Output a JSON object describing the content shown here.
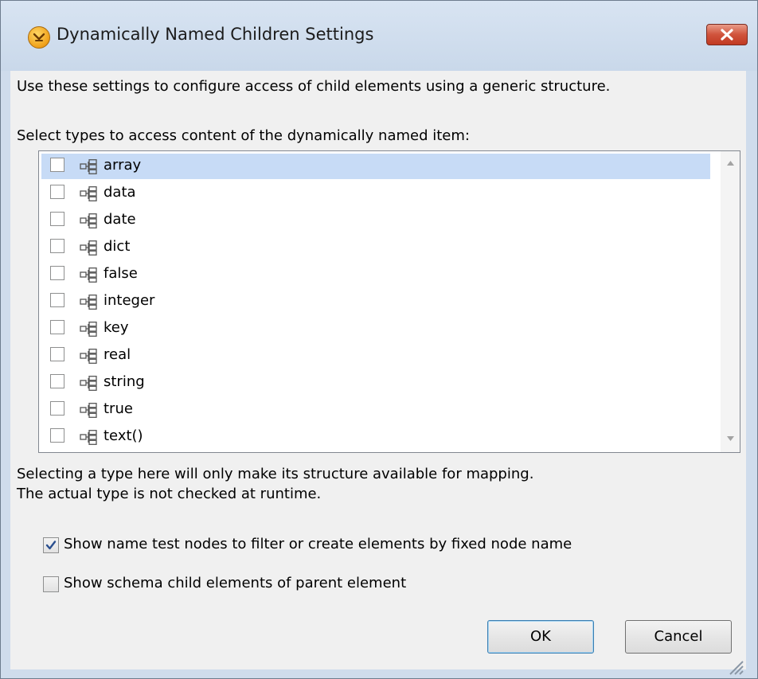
{
  "window": {
    "title": "Dynamically Named Children Settings",
    "icon": "app-logo-icon",
    "close_icon": "close-icon"
  },
  "description": "Use these settings to configure access of child elements using a generic structure.",
  "types_list": {
    "label": "Select types to access content of the dynamically named item:",
    "item_icon": "element-tree-icon",
    "selected_index": 0,
    "items": [
      {
        "label": "array",
        "checked": false
      },
      {
        "label": "data",
        "checked": false
      },
      {
        "label": "date",
        "checked": false
      },
      {
        "label": "dict",
        "checked": false
      },
      {
        "label": "false",
        "checked": false
      },
      {
        "label": "integer",
        "checked": false
      },
      {
        "label": "key",
        "checked": false
      },
      {
        "label": "real",
        "checked": false
      },
      {
        "label": "string",
        "checked": false
      },
      {
        "label": "true",
        "checked": false
      },
      {
        "label": "text()",
        "checked": false
      }
    ]
  },
  "info": {
    "line1": "Selecting a type here will only make its structure available for mapping.",
    "line2": "The actual type is not checked at runtime."
  },
  "options": {
    "show_name_test": {
      "label": "Show name test nodes to filter or create elements by fixed node name",
      "checked": true
    },
    "show_schema_children": {
      "label": "Show schema child elements of parent element",
      "checked": false
    }
  },
  "buttons": {
    "ok": "OK",
    "cancel": "Cancel"
  },
  "colors": {
    "selection": "#c7dbf6",
    "titlebar": "#cfdcec",
    "close_button": "#c9462e",
    "check_mark": "#2a4f8f"
  }
}
